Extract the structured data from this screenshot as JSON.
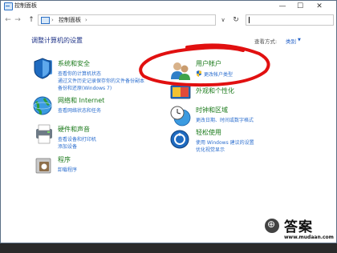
{
  "window": {
    "title": "控制面板",
    "min_glyph": "—",
    "max_glyph": "☐",
    "close_glyph": "✕"
  },
  "address": {
    "back_glyph": "←",
    "forward_glyph": "→",
    "up_glyph": "↑",
    "sep": "›",
    "path": "控制面板",
    "dropdown_glyph": "∨",
    "refresh_glyph": "↻"
  },
  "main": {
    "heading": "调整计算机的设置",
    "view_label": "查看方式:",
    "view_value": "类别",
    "view_caret": "▼"
  },
  "categories": [
    {
      "title": "系统和安全",
      "links": [
        "查看你的计算机状态",
        "通过文件历史记录保存你的文件备份副本",
        "备份和还原(Windows 7)"
      ]
    },
    {
      "title": "网络和 Internet",
      "links": [
        "查看网络状态和任务"
      ]
    },
    {
      "title": "硬件和声音",
      "links": [
        "查看设备和打印机",
        "添加设备"
      ]
    },
    {
      "title": "程序",
      "links": [
        "卸载程序"
      ]
    },
    {
      "title": "用户帐户",
      "links": [
        "更改帐户类型"
      ]
    },
    {
      "title": "外观和个性化",
      "links": []
    },
    {
      "title": "时钟和区域",
      "links": [
        "更改日期、时间或数字格式"
      ]
    },
    {
      "title": "轻松使用",
      "links": [
        "使用 Windows 建议的设置",
        "优化视觉显示"
      ]
    }
  ],
  "watermark": {
    "text": "答案",
    "url": "www.mudaan.com"
  },
  "colors": {
    "heading": "#1e3287",
    "category_title": "#1b7a1b",
    "link": "#2d6fcf",
    "annotation": "#e11010"
  }
}
